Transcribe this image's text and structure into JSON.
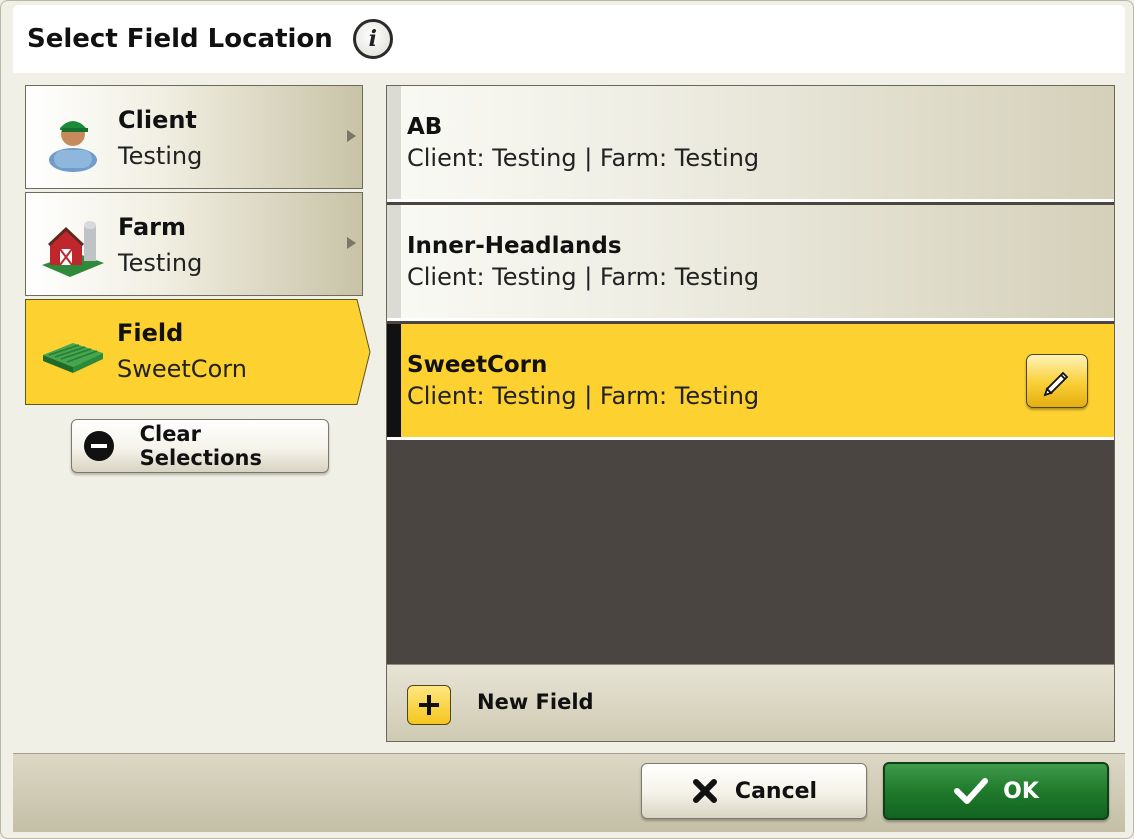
{
  "dialog": {
    "title": "Select Field Location",
    "info_icon": "info-icon"
  },
  "nav": {
    "items": [
      {
        "label": "Client",
        "value": "Testing",
        "icon": "client-person-icon",
        "selected": false
      },
      {
        "label": "Farm",
        "value": "Testing",
        "icon": "farm-barn-icon",
        "selected": false
      },
      {
        "label": "Field",
        "value": "SweetCorn",
        "icon": "field-icon",
        "selected": true
      }
    ],
    "clear_label": "Clear Selections"
  },
  "fields": {
    "rows": [
      {
        "name": "AB",
        "sub": "Client: Testing | Farm: Testing",
        "selected": false
      },
      {
        "name": "Inner-Headlands",
        "sub": "Client: Testing | Farm: Testing",
        "selected": false
      },
      {
        "name": "SweetCorn",
        "sub": "Client: Testing | Farm: Testing",
        "selected": true
      }
    ],
    "new_label": "New Field"
  },
  "footer": {
    "cancel_label": "Cancel",
    "ok_label": "OK"
  },
  "colors": {
    "selected_yellow": "#fdd130",
    "ok_green": "#1f7a2c",
    "list_bg": "#4a4540"
  }
}
